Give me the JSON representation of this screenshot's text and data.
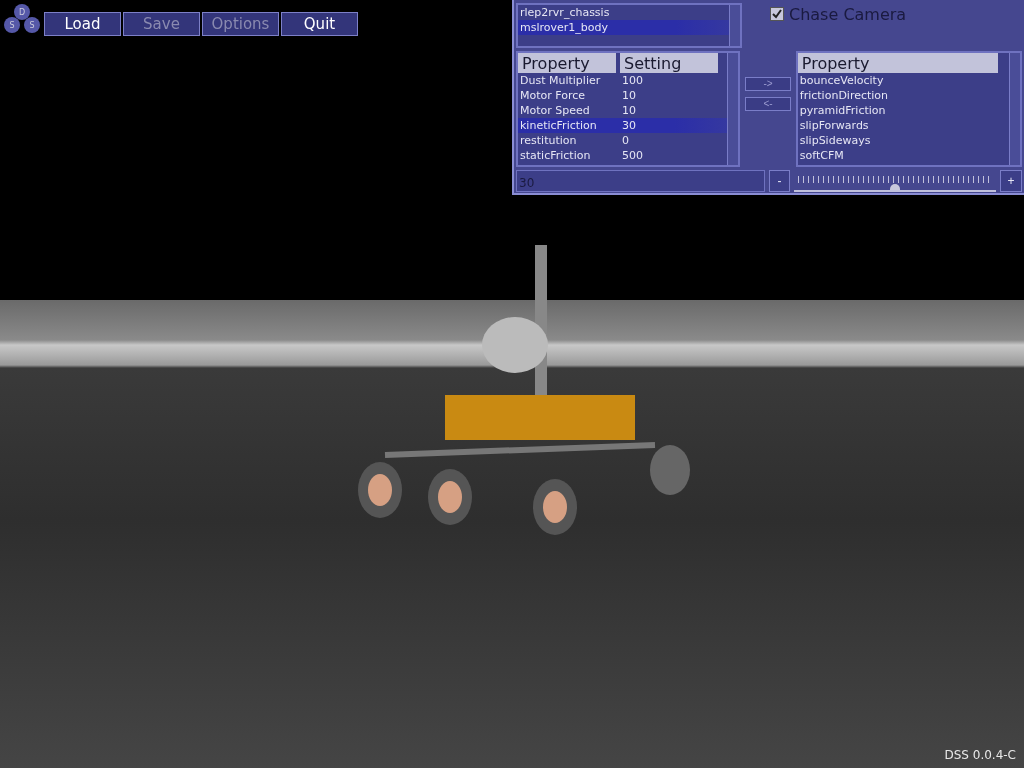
{
  "logo": {
    "letters": [
      "D",
      "S",
      "S"
    ]
  },
  "menu": [
    {
      "label": "Load",
      "disabled": false
    },
    {
      "label": "Save",
      "disabled": true
    },
    {
      "label": "Options",
      "disabled": true
    },
    {
      "label": "Quit",
      "disabled": false
    }
  ],
  "bodies": [
    {
      "label": "rlep2rvr_chassis",
      "selected": false
    },
    {
      "label": "mslrover1_body",
      "selected": true
    }
  ],
  "chase_camera": {
    "label": "Chase Camera",
    "checked": true
  },
  "settings_table": {
    "columns": [
      "Property",
      "Setting"
    ],
    "rows": [
      {
        "property": "Dust Multiplier",
        "setting": "100",
        "selected": false
      },
      {
        "property": "Motor Force",
        "setting": "10",
        "selected": false
      },
      {
        "property": "Motor Speed",
        "setting": "10",
        "selected": false
      },
      {
        "property": "kineticFriction",
        "setting": "30",
        "selected": true
      },
      {
        "property": "restitution",
        "setting": "0",
        "selected": false
      },
      {
        "property": "staticFriction",
        "setting": "500",
        "selected": false
      }
    ]
  },
  "move_buttons": [
    "->",
    "<-"
  ],
  "available_table": {
    "columns": [
      "Property"
    ],
    "rows": [
      "bounceVelocity",
      "frictionDirection",
      "pyramidFriction",
      "slipForwards",
      "slipSideways",
      "softCFM"
    ]
  },
  "value_field": {
    "value": "30"
  },
  "slider": {
    "minus": "-",
    "plus": "+",
    "level": 0.5
  },
  "version": "DSS 0.0.4-C"
}
